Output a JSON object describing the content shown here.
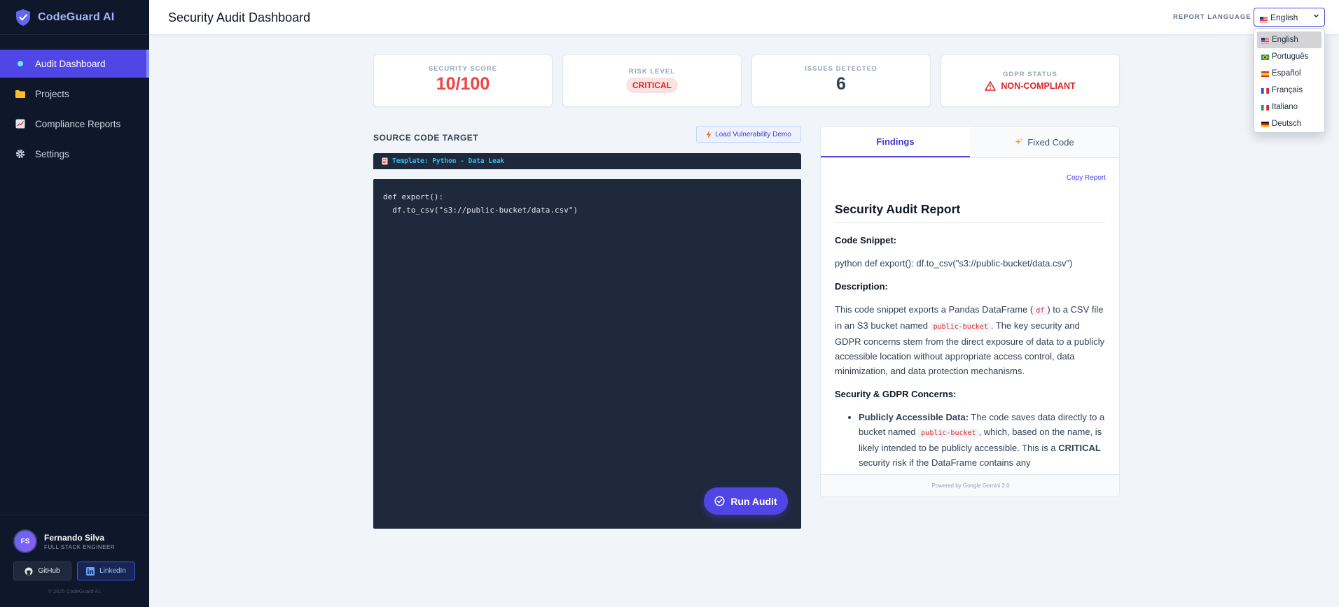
{
  "app": {
    "name": "CodeGuard AI"
  },
  "sidebar": {
    "items": [
      {
        "label": "Audit Dashboard",
        "icon": "dot-icon",
        "active": true
      },
      {
        "label": "Projects",
        "icon": "folder-icon"
      },
      {
        "label": "Compliance Reports",
        "icon": "chart-icon"
      },
      {
        "label": "Settings",
        "icon": "gear-icon"
      }
    ]
  },
  "user": {
    "initials": "FS",
    "name": "Fernando Silva",
    "role": "FULL STACK ENGINEER",
    "github_label": "GitHub",
    "linkedin_label": "LinkedIn",
    "copyright": "© 2025 CodeGuard AI."
  },
  "header": {
    "title": "Security Audit Dashboard",
    "language_label": "REPORT LANGUAGE",
    "selected_language": "English"
  },
  "languages": [
    {
      "label": "English",
      "flag": "us"
    },
    {
      "label": "Português",
      "flag": "br"
    },
    {
      "label": "Español",
      "flag": "es"
    },
    {
      "label": "Français",
      "flag": "fr"
    },
    {
      "label": "Italiano",
      "flag": "it"
    },
    {
      "label": "Deutsch",
      "flag": "de"
    }
  ],
  "stats": {
    "security_score_label": "SECURITY SCORE",
    "security_score": "10/100",
    "risk_level_label": "RISK LEVEL",
    "risk_level": "CRITICAL",
    "issues_label": "ISSUES DETECTED",
    "issues": "6",
    "gdpr_label": "GDPR STATUS",
    "gdpr_status": "NON-COMPLIANT"
  },
  "source": {
    "section_title": "SOURCE CODE TARGET",
    "demo_button": "Load Vulnerability Demo",
    "template_label": "Template: Python - Data Leak",
    "code": "def export():\n  df.to_csv(\"s3://public-bucket/data.csv\")",
    "run_button": "Run Audit"
  },
  "report": {
    "tab_findings": "Findings",
    "tab_fixed": "Fixed Code",
    "copy_label": "Copy Report",
    "title": "Security Audit Report",
    "snippet_heading": "Code Snippet:",
    "snippet_text": "python def export(): df.to_csv(\"s3://public-bucket/data.csv\")",
    "description_heading": "Description:",
    "desc_part1": "This code snippet exports a Pandas DataFrame (",
    "desc_code1": "df",
    "desc_part2": ") to a CSV file in an S3 bucket named ",
    "desc_code2": "public-bucket",
    "desc_part3": ". The key security and GDPR concerns stem from the direct exposure of data to a publicly accessible location without appropriate access control, data minimization, and data protection mechanisms.",
    "concerns_heading": "Security & GDPR Concerns:",
    "concern1_title": "Publicly Accessible Data:",
    "concern1_part1": " The code saves data directly to a bucket named ",
    "concern1_code": "public-bucket",
    "concern1_part2": ", which, based on the name, is likely intended to be publicly accessible. This is a ",
    "concern1_bold": "CRITICAL",
    "concern1_part3": " security risk if the DataFrame contains any",
    "footer": "Powered by Google Gemini 2.0"
  },
  "colors": {
    "accent": "#4f46e5",
    "sidebar_bg": "#0f172a",
    "danger": "#ef4444",
    "code_bg": "#1e293b"
  }
}
